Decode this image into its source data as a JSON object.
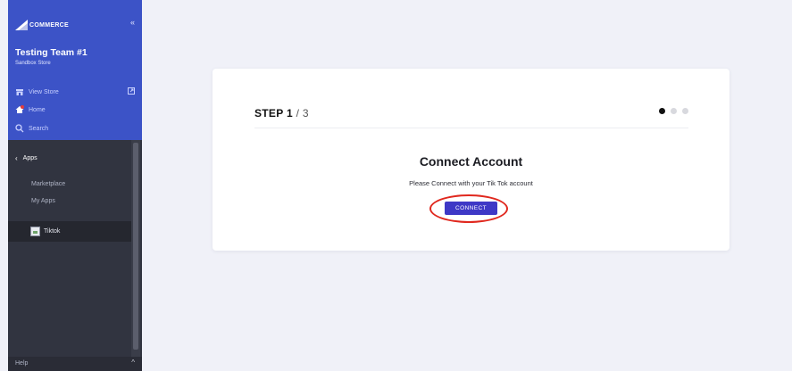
{
  "sidebar": {
    "brand": "COMMERCE",
    "store_name": "Testing Team #1",
    "store_sub": "Sandbox Store",
    "nav": [
      {
        "label": "View Store",
        "icon": "store-icon"
      },
      {
        "label": "Home",
        "icon": "home-icon",
        "badge": "notification"
      },
      {
        "label": "Search",
        "icon": "search-icon"
      }
    ],
    "apps_label": "Apps",
    "sub_items": [
      "Marketplace",
      "My Apps"
    ],
    "app_item": "Tiktok",
    "help_label": "Help",
    "colors": {
      "top": "#3c53c7",
      "body": "#313440"
    }
  },
  "card": {
    "step_current": "STEP 1",
    "step_total": " / 3",
    "steps_total": 3,
    "steps_active": 1,
    "title": "Connect Account",
    "description": "Please Connect with your Tik Tok account",
    "connect_label": "CONNECT",
    "accent": "#3e38c6",
    "highlight_color": "#e0281e"
  }
}
